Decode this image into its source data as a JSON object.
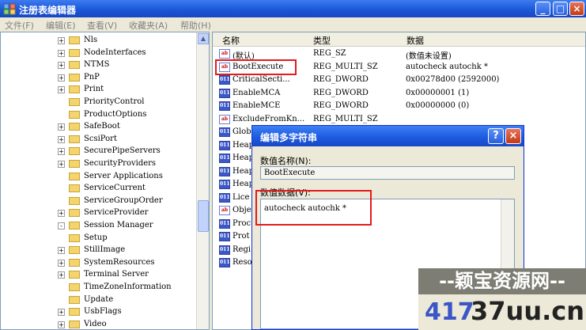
{
  "window": {
    "title": "注册表编辑器",
    "min": "_",
    "max": "□",
    "close": "×"
  },
  "menu": [
    "文件(F)",
    "编辑(E)",
    "查看(V)",
    "收藏夹(A)",
    "帮助(H)"
  ],
  "tree": {
    "items": [
      {
        "label": "Nls",
        "expander": "+"
      },
      {
        "label": "NodeInterfaces",
        "expander": "+"
      },
      {
        "label": "NTMS",
        "expander": "+"
      },
      {
        "label": "PnP",
        "expander": "+"
      },
      {
        "label": "Print",
        "expander": "+"
      },
      {
        "label": "PriorityControl",
        "expander": ""
      },
      {
        "label": "ProductOptions",
        "expander": ""
      },
      {
        "label": "SafeBoot",
        "expander": "+"
      },
      {
        "label": "ScsiPort",
        "expander": "+"
      },
      {
        "label": "SecurePipeServers",
        "expander": "+"
      },
      {
        "label": "SecurityProviders",
        "expander": "+"
      },
      {
        "label": "Server Applications",
        "expander": ""
      },
      {
        "label": "ServiceCurrent",
        "expander": ""
      },
      {
        "label": "ServiceGroupOrder",
        "expander": ""
      },
      {
        "label": "ServiceProvider",
        "expander": "+"
      },
      {
        "label": "Session Manager",
        "expander": "-"
      },
      {
        "label": "Setup",
        "expander": ""
      },
      {
        "label": "StillImage",
        "expander": "+"
      },
      {
        "label": "SystemResources",
        "expander": "+"
      },
      {
        "label": "Terminal Server",
        "expander": "+"
      },
      {
        "label": "TimeZoneInformation",
        "expander": ""
      },
      {
        "label": "Update",
        "expander": ""
      },
      {
        "label": "UsbFlags",
        "expander": "+"
      },
      {
        "label": "Video",
        "expander": "+"
      }
    ]
  },
  "list": {
    "headers": {
      "name": "名称",
      "type": "类型",
      "data": "数据"
    },
    "rows": [
      {
        "icon": "ab",
        "kind": "str",
        "name": "(默认)",
        "type": "REG_SZ",
        "data": "(数值未设置)"
      },
      {
        "icon": "ab",
        "kind": "str",
        "name": "BootExecute",
        "type": "REG_MULTI_SZ",
        "data": "autocheck autochk *"
      },
      {
        "icon": "011",
        "kind": "bin",
        "name": "CriticalSecti...",
        "type": "REG_DWORD",
        "data": "0x00278d00 (2592000)"
      },
      {
        "icon": "011",
        "kind": "bin",
        "name": "EnableMCA",
        "type": "REG_DWORD",
        "data": "0x00000001 (1)"
      },
      {
        "icon": "011",
        "kind": "bin",
        "name": "EnableMCE",
        "type": "REG_DWORD",
        "data": "0x00000000 (0)"
      },
      {
        "icon": "ab",
        "kind": "str",
        "name": "ExcludeFromKn...",
        "type": "REG_MULTI_SZ",
        "data": ""
      },
      {
        "icon": "011",
        "kind": "bin",
        "name": "Glob",
        "type": "",
        "data": ""
      },
      {
        "icon": "011",
        "kind": "bin",
        "name": "Heap",
        "type": "",
        "data": ""
      },
      {
        "icon": "011",
        "kind": "bin",
        "name": "Heap",
        "type": "",
        "data": ""
      },
      {
        "icon": "011",
        "kind": "bin",
        "name": "Heap",
        "type": "",
        "data": ""
      },
      {
        "icon": "011",
        "kind": "bin",
        "name": "Heap",
        "type": "",
        "data": ""
      },
      {
        "icon": "011",
        "kind": "bin",
        "name": "Lice",
        "type": "",
        "data": ""
      },
      {
        "icon": "ab",
        "kind": "str",
        "name": "Obje",
        "type": "",
        "data": ""
      },
      {
        "icon": "011",
        "kind": "bin",
        "name": "Proc",
        "type": "",
        "data": ""
      },
      {
        "icon": "011",
        "kind": "bin",
        "name": "Prot",
        "type": "",
        "data": ""
      },
      {
        "icon": "011",
        "kind": "bin",
        "name": "Regi",
        "type": "",
        "data": ""
      },
      {
        "icon": "011",
        "kind": "bin",
        "name": "Reso",
        "type": "",
        "data": ""
      }
    ]
  },
  "dialog": {
    "title": "编辑多字符串",
    "help": "?",
    "close": "×",
    "name_label": "数值名称(N):",
    "name_value": "BootExecute",
    "data_label": "数值数据(V):",
    "data_value": "autocheck autochk *"
  },
  "watermark": {
    "line1": "--颖宝资源网--",
    "line2a": "417",
    "line2b": "37uu.cn"
  },
  "colors": {
    "highlight": "#e21b1b",
    "titlebar": "#1c58d9"
  }
}
